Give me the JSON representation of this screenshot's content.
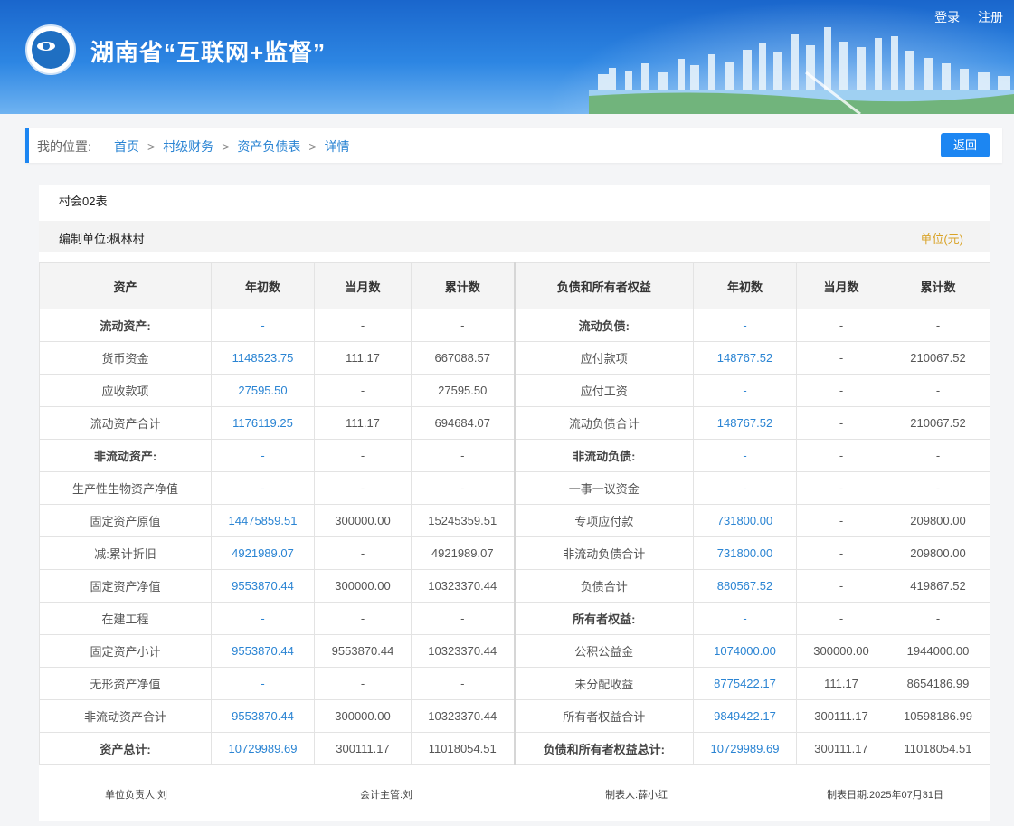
{
  "header": {
    "title": "湖南省“互联网+监督”",
    "login": "登录",
    "register": "注册"
  },
  "breadcrumb": {
    "prefix": "我的位置:",
    "items": [
      "首页",
      "村级财务",
      "资产负债表",
      "详情"
    ],
    "back": "返回"
  },
  "report": {
    "form_code": "村会02表",
    "org": "编制单位:枫林村",
    "unit": "单位(元)",
    "columns": [
      "资产",
      "年初数",
      "当月数",
      "累计数",
      "负债和所有者权益",
      "年初数",
      "当月数",
      "累计数"
    ],
    "rows": [
      [
        "流动资产:",
        "-",
        "-",
        "-",
        "流动负债:",
        "-",
        "-",
        "-"
      ],
      [
        "货币资金",
        "1148523.75",
        "111.17",
        "667088.57",
        "应付款项",
        "148767.52",
        "-",
        "210067.52"
      ],
      [
        "应收款项",
        "27595.50",
        "-",
        "27595.50",
        "应付工资",
        "-",
        "-",
        "-"
      ],
      [
        "流动资产合计",
        "1176119.25",
        "111.17",
        "694684.07",
        "流动负债合计",
        "148767.52",
        "-",
        "210067.52"
      ],
      [
        "非流动资产:",
        "-",
        "-",
        "-",
        "非流动负债:",
        "-",
        "-",
        "-"
      ],
      [
        "生产性生物资产净值",
        "-",
        "-",
        "-",
        "一事一议资金",
        "-",
        "-",
        "-"
      ],
      [
        "固定资产原值",
        "14475859.51",
        "300000.00",
        "15245359.51",
        "专项应付款",
        "731800.00",
        "-",
        "209800.00"
      ],
      [
        "减:累计折旧",
        "4921989.07",
        "-",
        "4921989.07",
        "非流动负债合计",
        "731800.00",
        "-",
        "209800.00"
      ],
      [
        "固定资产净值",
        "9553870.44",
        "300000.00",
        "10323370.44",
        "负债合计",
        "880567.52",
        "-",
        "419867.52"
      ],
      [
        "在建工程",
        "-",
        "-",
        "-",
        "所有者权益:",
        "-",
        "-",
        "-"
      ],
      [
        "固定资产小计",
        "9553870.44",
        "9553870.44",
        "10323370.44",
        "公积公益金",
        "1074000.00",
        "300000.00",
        "1944000.00"
      ],
      [
        "无形资产净值",
        "-",
        "-",
        "-",
        "未分配收益",
        "8775422.17",
        "111.17",
        "8654186.99"
      ],
      [
        "非流动资产合计",
        "9553870.44",
        "300000.00",
        "10323370.44",
        "所有者权益合计",
        "9849422.17",
        "300111.17",
        "10598186.99"
      ],
      [
        "资产总计:",
        "10729989.69",
        "300111.17",
        "11018054.51",
        "负债和所有者权益总计:",
        "10729989.69",
        "300111.17",
        "11018054.51"
      ]
    ],
    "bold_left": [
      0,
      4,
      13
    ],
    "bold_right": [
      0,
      4,
      9,
      13
    ]
  },
  "footer": {
    "head": "单位负责人:刘",
    "accountant": "会计主管:刘",
    "preparer": "制表人:薛小红",
    "date": "制表日期:2025年07月31日"
  }
}
